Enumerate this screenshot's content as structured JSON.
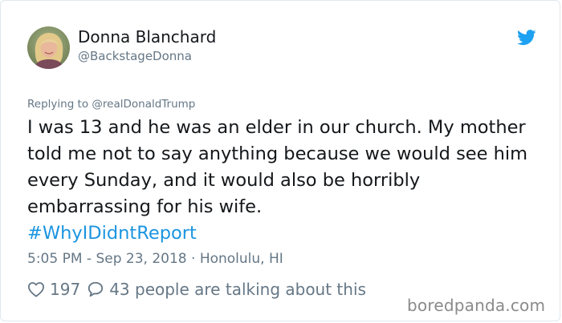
{
  "author": {
    "display_name": "Donna Blanchard",
    "handle": "@BackstageDonna",
    "avatar_icon": "profile-photo"
  },
  "brand_icon": "twitter-bird-icon",
  "reply": {
    "prefix": "Replying to ",
    "target": "@realDonaldTrump"
  },
  "tweet": {
    "text": "I was 13 and he was an elder in our church. My mother told me not to say anything because we would see him every Sunday, and it would also be horribly embarrassing for his wife.",
    "hashtag": "#WhyIDidntReport"
  },
  "meta": {
    "timestamp": "5:05 PM - Sep 23, 2018",
    "separator": "·",
    "location": "Honolulu, HI"
  },
  "engagement": {
    "likes": "197",
    "talking_text": "43 people are talking about this"
  },
  "watermark": "boredpanda.com",
  "colors": {
    "text": "#14171a",
    "muted": "#657786",
    "link": "#1b95e0",
    "twitter_blue": "#1da1f2"
  }
}
